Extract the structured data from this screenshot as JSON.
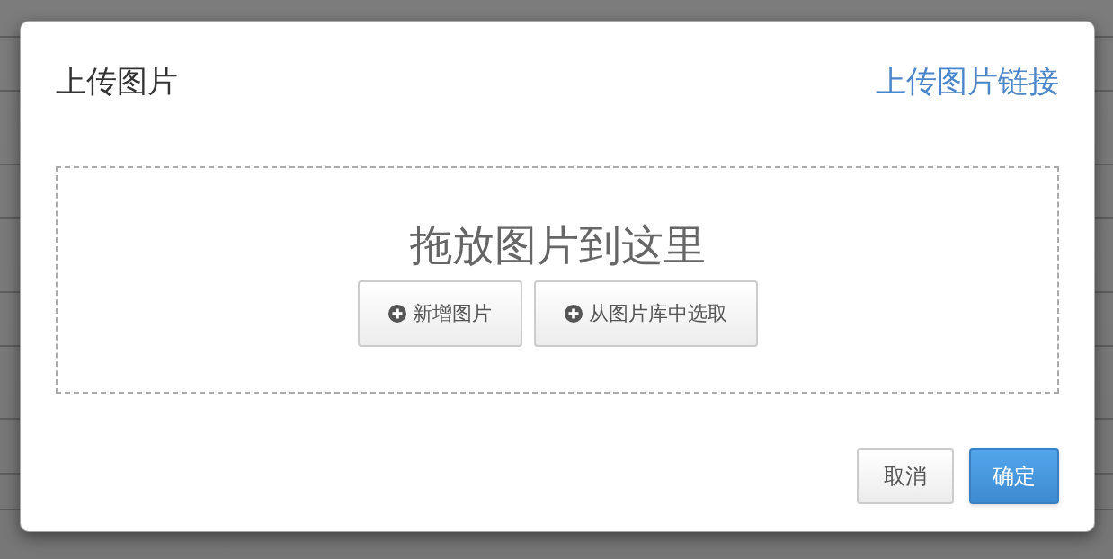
{
  "dialog": {
    "title": "上传图片",
    "link": "上传图片链接"
  },
  "drop_zone": {
    "prompt": "拖放图片到这里",
    "buttons": [
      {
        "label": "新增图片"
      },
      {
        "label": "从图片库中选取"
      }
    ]
  },
  "footer": {
    "buttons": [
      {
        "label": "取消",
        "kind": "secondary"
      },
      {
        "label": "确定",
        "kind": "primary"
      }
    ]
  }
}
